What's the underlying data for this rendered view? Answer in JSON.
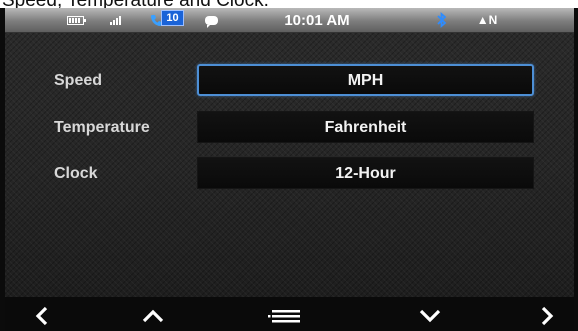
{
  "caption": "Speed, Temperature and Clock.",
  "status_bar": {
    "icons": [
      "battery-icon",
      "signal-icon",
      "phone-icon",
      "message-icon",
      "bluetooth-icon"
    ],
    "missed_calls": "10",
    "time": "10:01 AM",
    "compass": "▲N",
    "colors": {
      "bluetooth": "#2e8cff",
      "badge": "#1a63d8"
    }
  },
  "settings": [
    {
      "label": "Speed",
      "value": "MPH",
      "selected": true
    },
    {
      "label": "Temperature",
      "value": "Fahrenheit",
      "selected": false
    },
    {
      "label": "Clock",
      "value": "12-Hour",
      "selected": false
    }
  ],
  "nav": {
    "icons": [
      "chevron-left-icon",
      "chevron-up-icon",
      "menu-icon",
      "chevron-down-icon",
      "chevron-right-icon"
    ]
  },
  "colors": {
    "selection_border": "#4d8fd6"
  }
}
